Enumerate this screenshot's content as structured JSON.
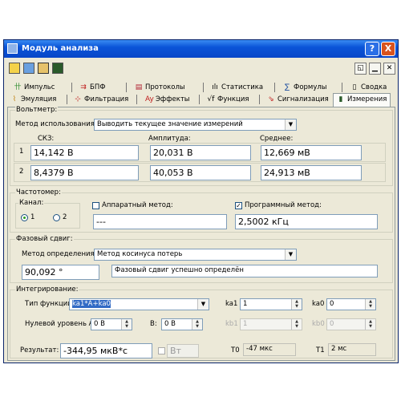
{
  "window": {
    "title": "Модуль анализа",
    "help_label": "?",
    "close_label": "X"
  },
  "toolbar": {
    "icons": [
      "open-icon",
      "columns-icon",
      "network-icon",
      "chart-icon"
    ],
    "restore_icons": [
      "restore-icon",
      "minimize-icon",
      "close-icon"
    ]
  },
  "tabs_row1": [
    {
      "label": "Импульс",
      "icon": "pulse-icon"
    },
    {
      "label": "БПФ",
      "icon": "fft-icon"
    },
    {
      "label": "Протоколы",
      "icon": "protocol-icon"
    },
    {
      "label": "Статистика",
      "icon": "statistics-icon"
    },
    {
      "label": "Формулы",
      "icon": "formula-icon"
    },
    {
      "label": "Сводка",
      "icon": "summary-icon"
    }
  ],
  "tabs_row2": [
    {
      "label": "Эмуляция",
      "icon": "emulation-icon"
    },
    {
      "label": "Фильтрация",
      "icon": "filter-icon"
    },
    {
      "label": "Эффекты",
      "icon": "effects-icon"
    },
    {
      "label": "Функция",
      "icon": "function-icon"
    },
    {
      "label": "Сигнализация",
      "icon": "alarm-icon"
    },
    {
      "label": "Измерения",
      "icon": "measure-icon",
      "selected": true
    }
  ],
  "voltmeter": {
    "title": "Вольтметр:",
    "method_label": "Метод использования:",
    "method_value": "Выводить текущее значение измерений",
    "col_rms": "СКЗ:",
    "col_amp": "Амплитуда:",
    "col_avg": "Среднее:",
    "rows": [
      {
        "num": "1",
        "rms": "14,142 В",
        "amp": "20,031 В",
        "avg": "12,669 мВ"
      },
      {
        "num": "2",
        "rms": "8,4379 В",
        "amp": "40,053 В",
        "avg": "24,913 мВ"
      }
    ]
  },
  "freq": {
    "title": "Частотомер:",
    "channel_label": "Канал:",
    "ch1": "1",
    "ch2": "2",
    "hw_label": "Аппаратный метод:",
    "hw_checked": false,
    "hw_value": "---",
    "sw_label": "Программный метод:",
    "sw_checked": true,
    "sw_mark": "✓",
    "sw_value": "2,5002 кГц"
  },
  "phase": {
    "title": "Фазовый сдвиг:",
    "method_label": "Метод определения:",
    "method_value": "Метод косинуса потерь",
    "value": "90,092 °",
    "status": "Фазовый сдвиг успешно определён"
  },
  "integ": {
    "title": "Интегрирование:",
    "func_label": "Тип функции:",
    "func_value": "ka1*A+ka0",
    "ka1_label": "ka1",
    "ka1_value": "1",
    "ka0_label": "ka0",
    "ka0_value": "0",
    "zero_a_label": "Нулевой уровень А:",
    "zero_a_value": "0 В",
    "b_label": "В:",
    "b_value": "0 В",
    "kb1_label": "kb1",
    "kb1_value": "1",
    "kb0_label": "kb0",
    "kb0_value": "0",
    "result_label": "Результат:",
    "result_value": "-344,95 мкВ*с",
    "vt_label": "Вт",
    "t0_label": "T0",
    "t0_value": "-47 мкс",
    "t1_label": "T1",
    "t1_value": "2 мс"
  }
}
